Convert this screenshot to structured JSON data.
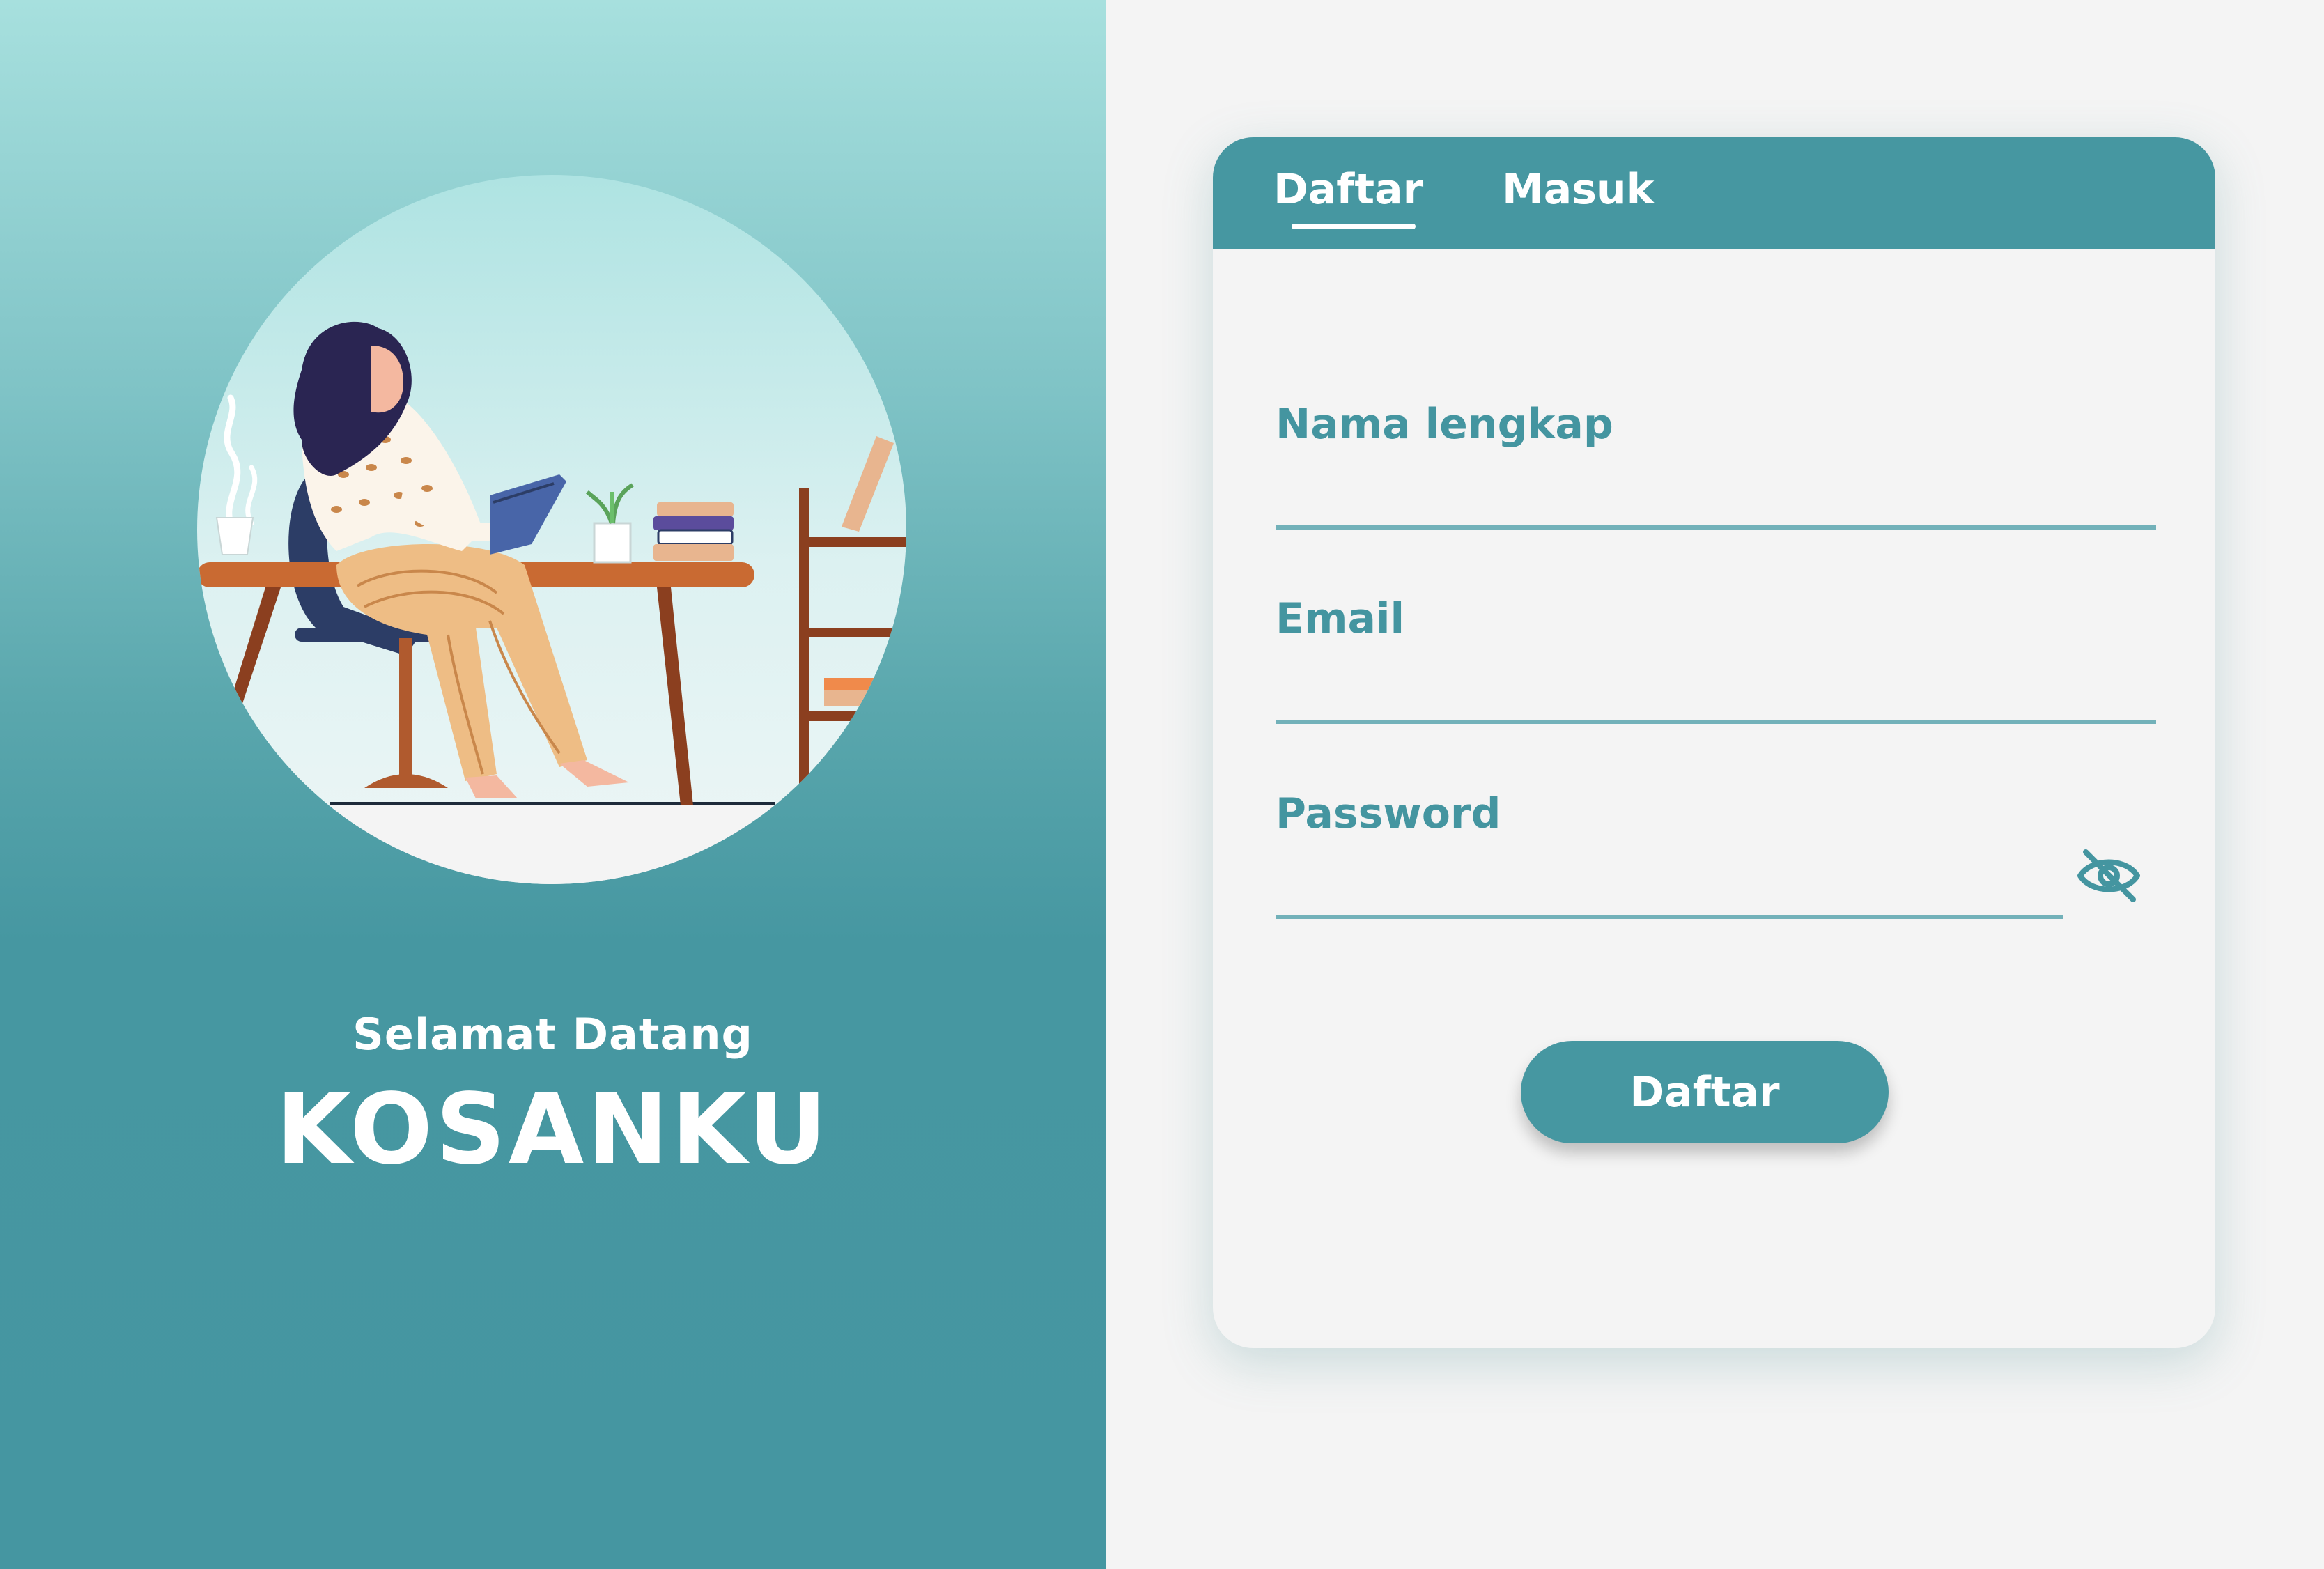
{
  "welcome": {
    "subtitle": "Selamat Datang",
    "app_name": "KOSANKU"
  },
  "tabs": [
    {
      "label": "Daftar",
      "active": true
    },
    {
      "label": "Masuk",
      "active": false
    }
  ],
  "form": {
    "fields": [
      {
        "label": "Nama lengkap",
        "value": ""
      },
      {
        "label": "Email",
        "value": ""
      },
      {
        "label": "Password",
        "value": ""
      }
    ],
    "password_toggle_icon": "eye-slash-icon",
    "submit_label": "Daftar"
  },
  "illustration": {
    "name": "woman-reading-at-desk-illustration"
  },
  "colors": {
    "brand": "#4697a1",
    "label": "#4495a0",
    "input_line": "#72b1b9",
    "gradient_top": "#a7e0de",
    "background": "#f4f4f4"
  }
}
